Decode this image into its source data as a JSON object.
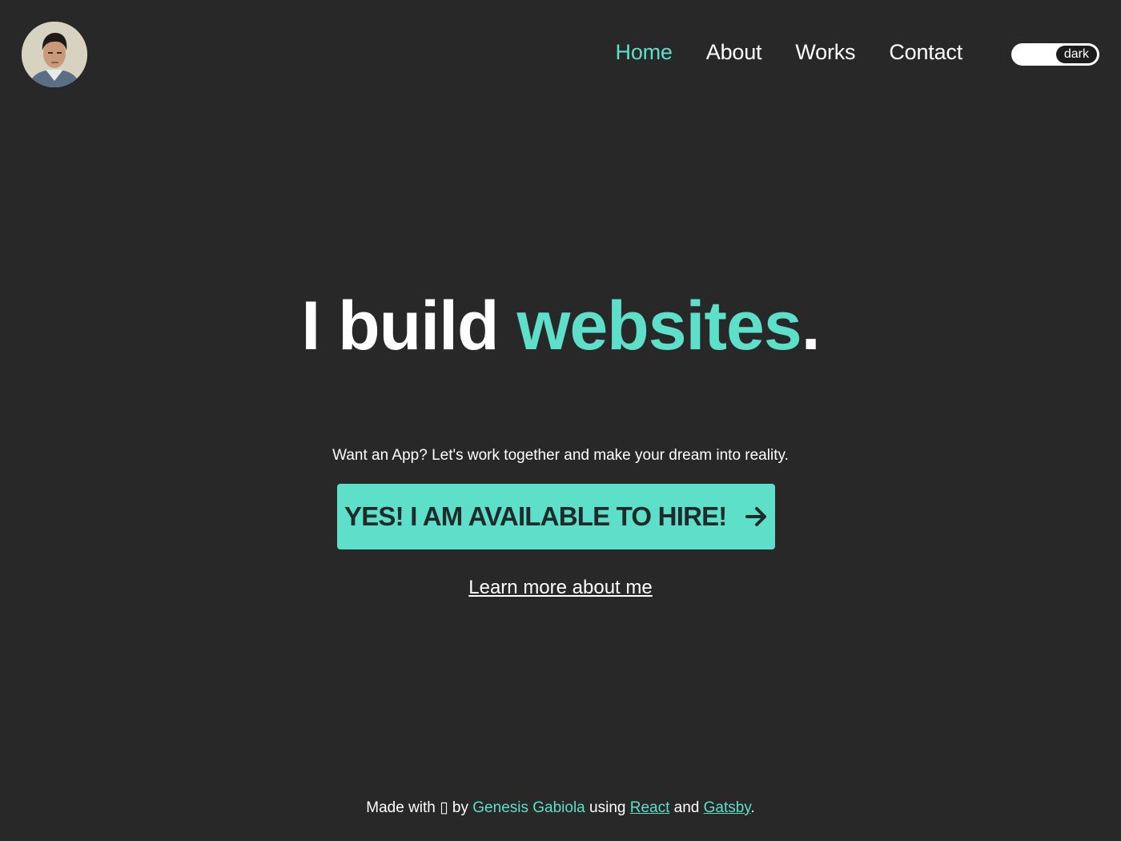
{
  "header": {
    "avatar_alt": "Profile photo",
    "nav": [
      {
        "label": "Home",
        "active": true
      },
      {
        "label": "About",
        "active": false
      },
      {
        "label": "Works",
        "active": false
      },
      {
        "label": "Contact",
        "active": false
      }
    ],
    "theme_toggle": {
      "label": "dark"
    }
  },
  "hero": {
    "title_prefix": "I build ",
    "title_accent": "websites",
    "title_suffix": ".",
    "tagline": "Want an App? Let's work together and make your dream into reality.",
    "cta_label": "YES! I AM AVAILABLE TO HIRE!",
    "cta_icon": "arrow-right-icon",
    "learn_more": "Learn more about me"
  },
  "footer": {
    "made_with": "Made with",
    "heart_glyph": "▯",
    "by": "by",
    "author": "Genesis Gabiola",
    "using": "using",
    "tech1": "React",
    "and": "and",
    "tech2": "Gatsby",
    "end": "."
  },
  "colors": {
    "background": "#282828",
    "accent": "#5ddfca",
    "text": "#ffffff"
  }
}
